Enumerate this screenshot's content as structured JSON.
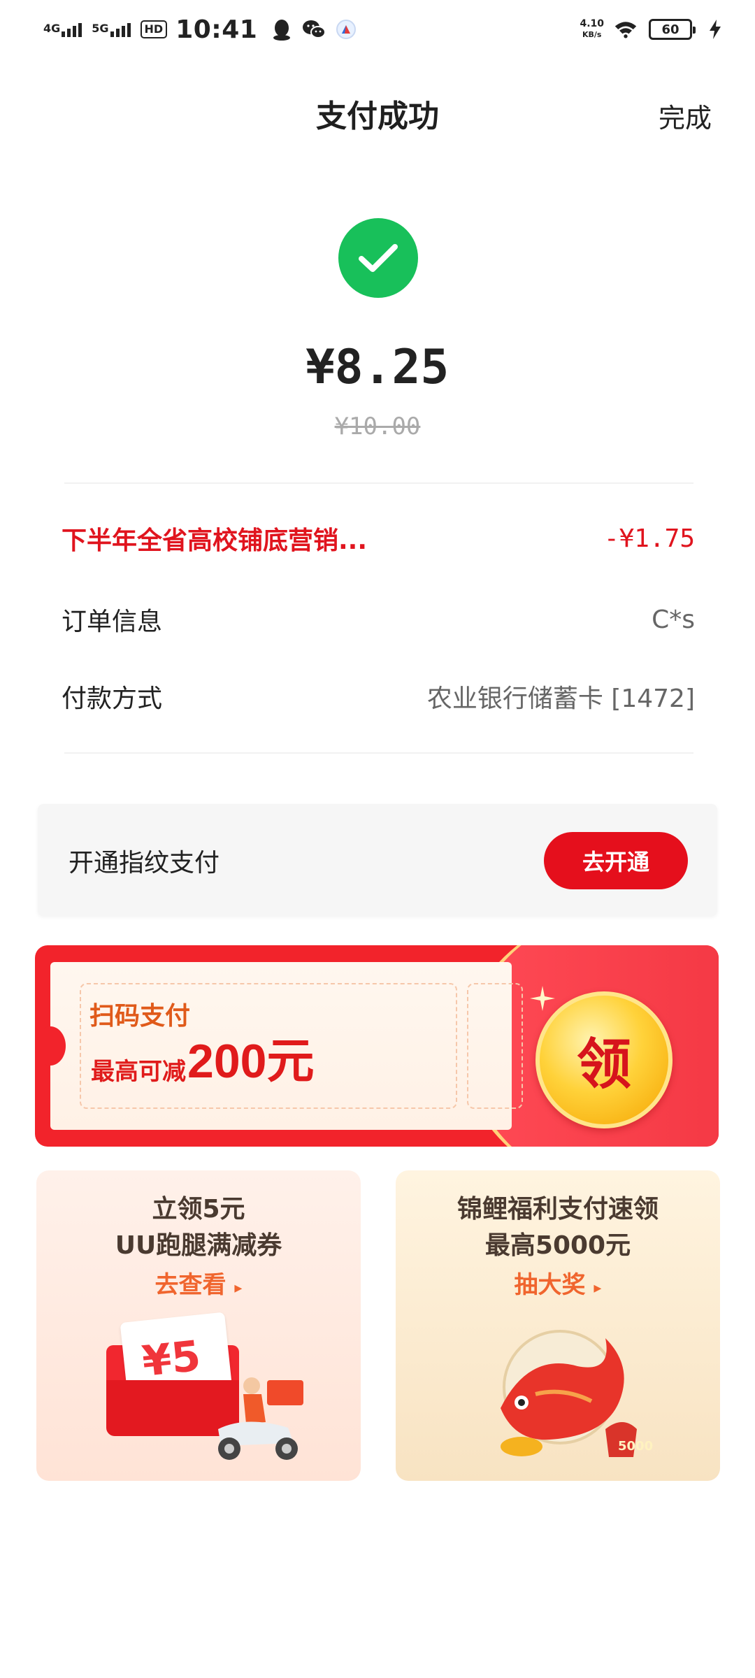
{
  "status_bar": {
    "net1": "4G",
    "net2": "5G",
    "hd": "HD",
    "time": "10:41",
    "speed_value": "4.10",
    "speed_unit": "KB/s",
    "battery": "60"
  },
  "header": {
    "title": "支付成功",
    "done_label": "完成"
  },
  "payment": {
    "amount": "¥8.25",
    "original_amount": "¥10.00"
  },
  "details": {
    "promo_label": "下半年全省高校铺底营销...",
    "promo_value": "-¥1.75",
    "order_label": "订单信息",
    "order_value": "C*s",
    "method_label": "付款方式",
    "method_value": "农业银行储蓄卡 [1472]"
  },
  "fingerprint": {
    "label": "开通指纹支付",
    "button": "去开通"
  },
  "banner": {
    "line1": "扫码支付",
    "line2_prefix": "最高可减",
    "line2_amount": "200元",
    "coin_label": "领"
  },
  "card_left": {
    "line1": "立领5元",
    "line2": "UU跑腿满减券",
    "cta": "去查看",
    "ticket_value": "¥5"
  },
  "card_right": {
    "line1": "锦鲤福利支付速领",
    "line2": "最高5000元",
    "cta": "抽大奖",
    "bag_value": "5000"
  },
  "colors": {
    "success_green": "#18c05a",
    "brand_red": "#e50f1c",
    "promo_red": "#e0141e"
  }
}
